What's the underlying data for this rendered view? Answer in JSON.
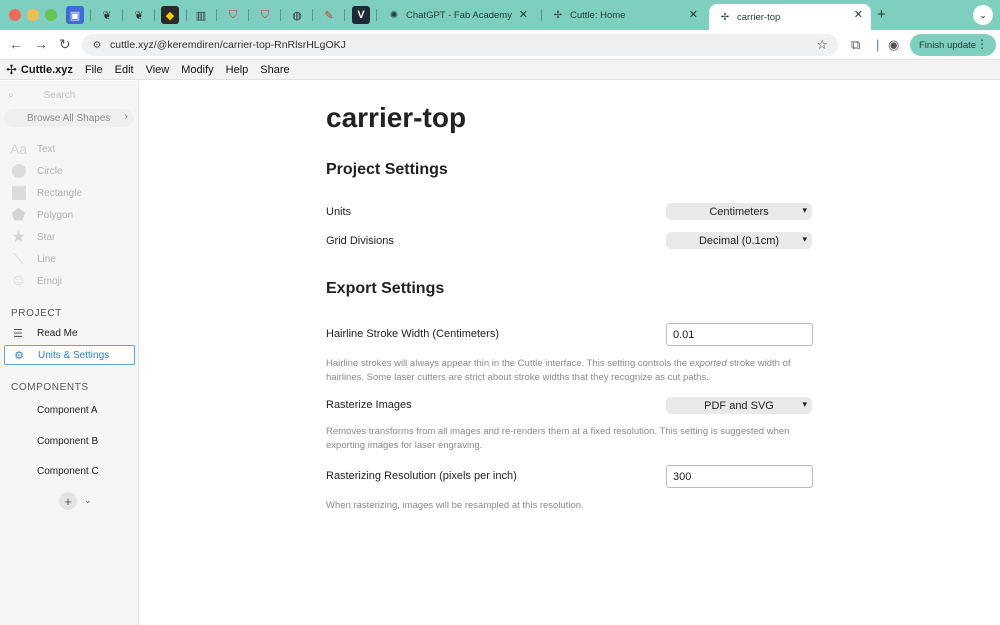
{
  "browser": {
    "tabs": [
      {
        "title": "ChatGPT - Fab Academy"
      },
      {
        "title": "Cuttle: Home"
      },
      {
        "title": "carrier-top"
      }
    ],
    "url": "cuttle.xyz/@keremdiren/carrier-top-RnRlsrHLgOKJ",
    "finish_update_label": "Finish update",
    "colors": {
      "tabstrip": "#7ecfc0"
    }
  },
  "app": {
    "brand": "Cuttle.xyz",
    "menu": [
      "File",
      "Edit",
      "View",
      "Modify",
      "Help",
      "Share"
    ]
  },
  "sidebar": {
    "search_placeholder": "Search",
    "browse_label": "Browse All Shapes",
    "shapes": [
      {
        "label": "Text",
        "icon": "text-icon"
      },
      {
        "label": "Circle",
        "icon": "circle-icon"
      },
      {
        "label": "Rectangle",
        "icon": "rectangle-icon"
      },
      {
        "label": "Polygon",
        "icon": "polygon-icon"
      },
      {
        "label": "Star",
        "icon": "star-icon"
      },
      {
        "label": "Line",
        "icon": "line-icon"
      },
      {
        "label": "Emoji",
        "icon": "emoji-icon"
      }
    ],
    "project_heading": "PROJECT",
    "project_items": [
      {
        "label": "Read Me",
        "icon": "document-icon"
      },
      {
        "label": "Units & Settings",
        "icon": "gear-icon",
        "selected": true
      }
    ],
    "components_heading": "COMPONENTS",
    "components": [
      "Component A",
      "Component B",
      "Component C"
    ]
  },
  "main": {
    "title": "carrier-top",
    "project_settings": {
      "heading": "Project Settings",
      "units_label": "Units",
      "units_value": "Centimeters",
      "grid_label": "Grid Divisions",
      "grid_value": "Decimal (0.1cm)"
    },
    "export_settings": {
      "heading": "Export Settings",
      "hairline_label": "Hairline Stroke Width (Centimeters)",
      "hairline_value": "0.01",
      "hairline_help_1": "Hairline strokes will always appear thin in the Cuttle interface. This setting controls the ",
      "hairline_help_em": "exported",
      "hairline_help_2": " stroke width of hairlines. Some laser cutters are strict about stroke widths that they recognize as cut paths.",
      "rasterize_label": "Rasterize Images",
      "rasterize_value": "PDF and SVG",
      "rasterize_help": "Removes transforms from all images and re-renders them at a fixed resolution. This setting is suggested when exporting images for laser engraving.",
      "resolution_label": "Rasterizing Resolution (pixels per inch)",
      "resolution_value": "300",
      "resolution_help": "When rasterizing, images will be resampled at this resolution."
    }
  }
}
